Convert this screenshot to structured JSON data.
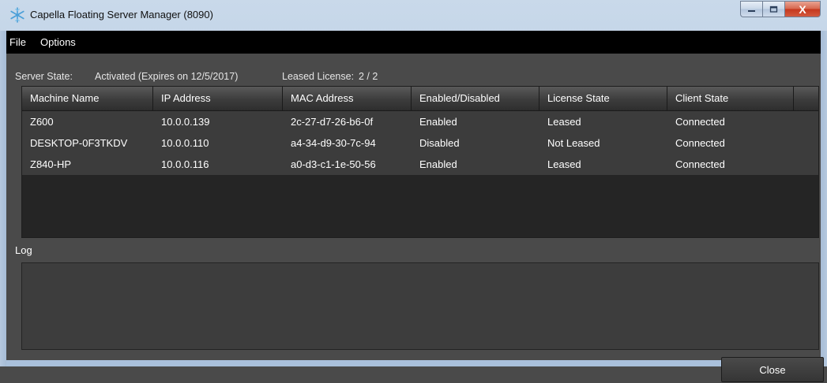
{
  "window": {
    "title": "Capella Floating Server Manager (8090)",
    "minimize_label": "—",
    "maximize_label": "□",
    "close_label": "X"
  },
  "menu": {
    "items": [
      "File",
      "Options"
    ]
  },
  "status": {
    "server_state_label": "Server State:",
    "server_state_value": "Activated (Expires on  12/5/2017)",
    "leased_license_label": "Leased License:",
    "leased_license_value": "2 / 2"
  },
  "table": {
    "columns": [
      "Machine Name",
      "IP Address",
      "MAC Address",
      "Enabled/Disabled",
      "License State",
      "Client State"
    ],
    "rows": [
      [
        "Z600",
        "10.0.0.139",
        "2c-27-d7-26-b6-0f",
        "Enabled",
        "Leased",
        "Connected"
      ],
      [
        "DESKTOP-0F3TKDV",
        "10.0.0.110",
        "a4-34-d9-30-7c-94",
        "Disabled",
        "Not Leased",
        "Connected"
      ],
      [
        "Z840-HP",
        "10.0.0.116",
        "a0-d3-c1-1e-50-56",
        "Enabled",
        "Leased",
        "Connected"
      ]
    ]
  },
  "log": {
    "label": "Log",
    "content": ""
  },
  "footer": {
    "close_label": "Close"
  },
  "icons": {
    "app": "snowflake-icon"
  },
  "colors": {
    "menubar": "#000000",
    "client_bg": "#4a4a4a",
    "table_row": "#3c3c3c",
    "table_empty": "#252525"
  }
}
